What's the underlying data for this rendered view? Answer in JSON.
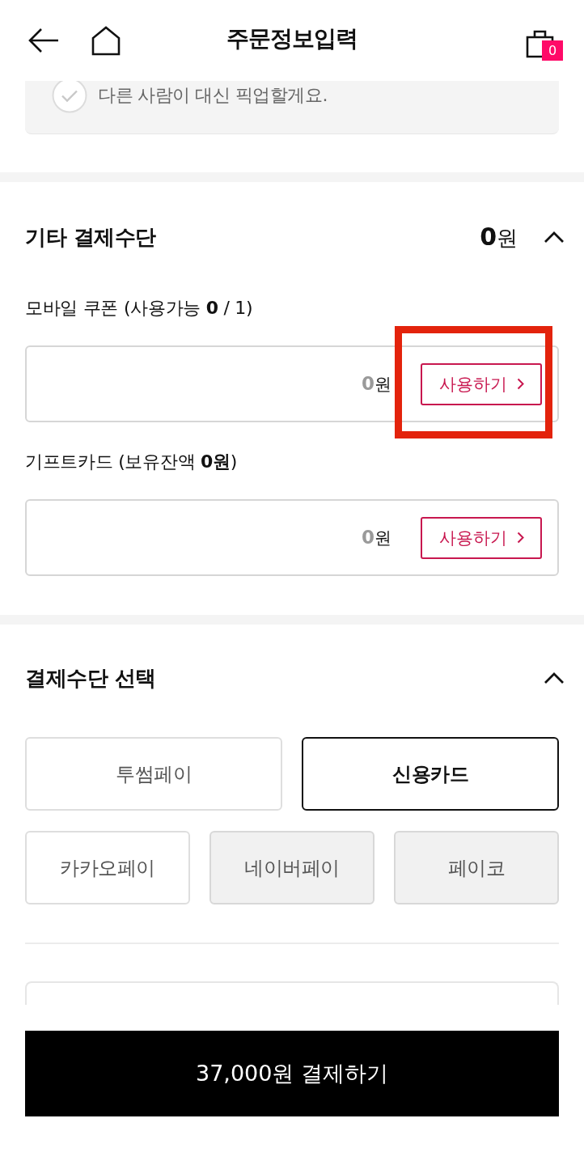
{
  "header": {
    "title": "주문정보입력",
    "cart_count": "0"
  },
  "pickup_option": {
    "label": "다른 사람이 대신 픽업할게요.",
    "checked": false
  },
  "other_payment": {
    "title": "기타 결제수단",
    "total": "**0**원",
    "expanded": true,
    "items": [
      {
        "label": "모바일 쿠폰 (사용가능 **0** / 1)",
        "amount": "**0**원",
        "button": "사용하기",
        "highlighted": true
      },
      {
        "label": "기프트카드 (보유잔액 **0원**)",
        "amount": "**0**원",
        "button": "사용하기",
        "highlighted": false
      }
    ]
  },
  "payment_method": {
    "title": "결제수단 선택",
    "expanded": true,
    "rows": [
      {
        "options": [
          {
            "label": "투썸페이",
            "selected": false,
            "disabled": false
          },
          {
            "label": "신용카드",
            "selected": true,
            "disabled": false
          }
        ]
      },
      {
        "options": [
          {
            "label": "카카오페이",
            "selected": false,
            "disabled": false
          },
          {
            "label": "네이버페이",
            "selected": false,
            "disabled": true
          },
          {
            "label": "페이코",
            "selected": false,
            "disabled": true
          }
        ]
      }
    ]
  },
  "pay_button": "37,000원 결제하기"
}
